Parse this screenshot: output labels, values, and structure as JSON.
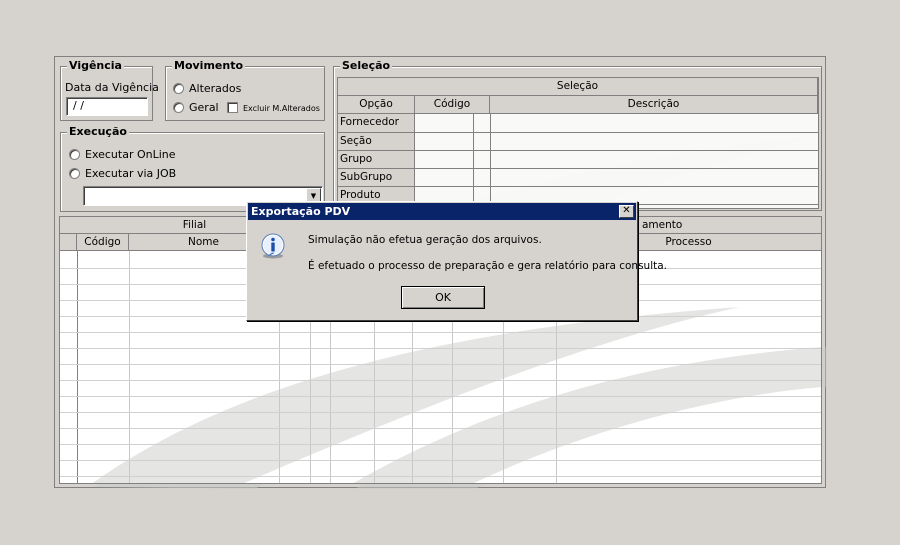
{
  "vigencia": {
    "title": "Vigência",
    "date_label": "Data da Vigência",
    "date_value": " / /"
  },
  "movimento": {
    "title": "Movimento",
    "option_alterados": "Alterados",
    "option_geral": "Geral",
    "excluir_label": "Excluir M.Alterados"
  },
  "execucao": {
    "title": "Execução",
    "option_online": "Executar OnLine",
    "option_job": "Executar via JOB",
    "job_value": ""
  },
  "selecao": {
    "title": "Seleção",
    "grid_header": "Seleção",
    "columns": [
      "Opção",
      "Código",
      "Descrição"
    ],
    "rows": [
      "Fornecedor",
      "Seção",
      "Grupo",
      "SubGrupo",
      "Produto"
    ]
  },
  "lower_grid": {
    "group_left": "Filial",
    "group_right": "amento",
    "col_codigo": "Código",
    "col_nome": "Nome",
    "col_processo": "Processo"
  },
  "dialog": {
    "title": "Exportação PDV",
    "close_glyph": "✕",
    "message_1": "Simulação não efetua geração dos arquivos.",
    "message_2": "É efetuado o processo de preparação e gera relatório para consulta.",
    "ok_label": "OK",
    "icon": "info-icon"
  },
  "colors": {
    "titlebar": "#0a246a",
    "face": "#d6d3ce"
  }
}
